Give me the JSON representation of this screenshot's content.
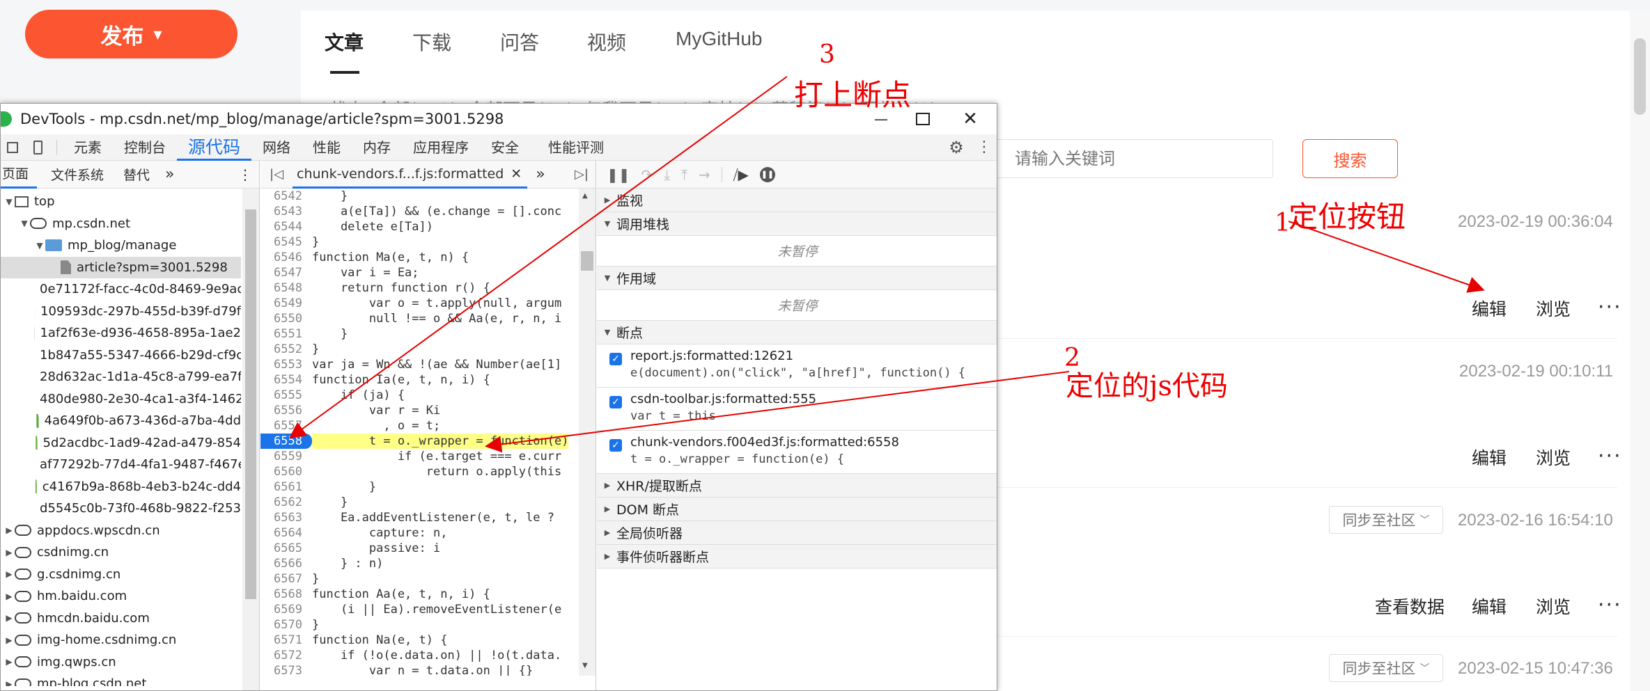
{
  "site": {
    "publish_label": "发布",
    "tabs": [
      "文章",
      "下载",
      "问答",
      "视频",
      "MyGitHub"
    ],
    "subtabs_visible": "状态  全部(112)  全部可见(65)  仅我可见(44)  审核(0)  草稿箱(1)  回收站(6)",
    "search_placeholder": "请输入关键词",
    "search_button": "搜索",
    "articles": [
      {
        "date": "2023-02-19 00:36:04",
        "actions": [
          "编辑",
          "浏览"
        ],
        "more": "···"
      },
      {
        "date": "2023-02-19 00:10:11",
        "actions": [
          "编辑",
          "浏览"
        ],
        "more": "···"
      },
      {
        "date": "2023-02-16 16:54:10",
        "sync": "同步至社区",
        "actions": [
          "查看数据",
          "编辑",
          "浏览"
        ],
        "more": "···"
      },
      {
        "date": "2023-02-15 10:47:36",
        "sync": "同步至社区"
      }
    ]
  },
  "devtools": {
    "title": "DevTools - mp.csdn.net/mp_blog/manage/article?spm=3001.5298",
    "panel_tabs": [
      "元素",
      "控制台",
      "源代码",
      "网络",
      "性能",
      "内存",
      "应用程序",
      "安全",
      "性能评测"
    ],
    "active_panel": "源代码",
    "nav_tabs": [
      "页面",
      "文件系统",
      "替代"
    ],
    "tree": [
      {
        "label": "top",
        "kind": "box",
        "indent": 0,
        "tri": "▼"
      },
      {
        "label": "mp.csdn.net",
        "kind": "cloud",
        "indent": 1,
        "tri": "▼"
      },
      {
        "label": "mp_blog/manage",
        "kind": "folder",
        "indent": 2,
        "tri": "▼"
      },
      {
        "label": "article?spm=3001.5298",
        "kind": "gray",
        "indent": 3,
        "tri": "",
        "selected": true
      },
      {
        "label": "0e71172f-facc-4c0d-8469-9e9ac",
        "kind": "file",
        "indent": 2,
        "tri": ""
      },
      {
        "label": "109593dc-297b-455d-b39f-d79f",
        "kind": "file",
        "indent": 2,
        "tri": ""
      },
      {
        "label": "1af2f63e-d936-4658-895a-1ae2",
        "kind": "file",
        "indent": 2,
        "tri": ""
      },
      {
        "label": "1b847a55-5347-4666-b29d-cf9c",
        "kind": "file",
        "indent": 2,
        "tri": ""
      },
      {
        "label": "28d632ac-1d1a-45c8-a799-ea7f",
        "kind": "file",
        "indent": 2,
        "tri": ""
      },
      {
        "label": "480de980-2e30-4ca1-a3f4-1462",
        "kind": "file",
        "indent": 2,
        "tri": ""
      },
      {
        "label": "4a649f0b-a673-436d-a7ba-4dd",
        "kind": "file",
        "indent": 2,
        "tri": ""
      },
      {
        "label": "5d2acdbc-1ad9-42ad-a479-854",
        "kind": "file",
        "indent": 2,
        "tri": ""
      },
      {
        "label": "af77292b-77d4-4fa1-9487-f467e",
        "kind": "file",
        "indent": 2,
        "tri": ""
      },
      {
        "label": "c4167b9a-868b-4eb3-b24c-dd4",
        "kind": "file",
        "indent": 2,
        "tri": ""
      },
      {
        "label": "d5545c0b-73f0-468b-9822-f253",
        "kind": "file",
        "indent": 2,
        "tri": ""
      },
      {
        "label": "appdocs.wpscdn.cn",
        "kind": "cloud",
        "indent": 0,
        "tri": "▶"
      },
      {
        "label": "csdnimg.cn",
        "kind": "cloud",
        "indent": 0,
        "tri": "▶"
      },
      {
        "label": "g.csdnimg.cn",
        "kind": "cloud",
        "indent": 0,
        "tri": "▶"
      },
      {
        "label": "hm.baidu.com",
        "kind": "cloud",
        "indent": 0,
        "tri": "▶"
      },
      {
        "label": "hmcdn.baidu.com",
        "kind": "cloud",
        "indent": 0,
        "tri": "▶"
      },
      {
        "label": "img-home.csdnimg.cn",
        "kind": "cloud",
        "indent": 0,
        "tri": "▶"
      },
      {
        "label": "img.qwps.cn",
        "kind": "cloud",
        "indent": 0,
        "tri": "▶"
      },
      {
        "label": "mp-blog.csdn.net",
        "kind": "cloud",
        "indent": 0,
        "tri": "▶"
      }
    ],
    "editor_tab": "chunk-vendors.f...f.js:formatted",
    "code": [
      {
        "n": "6542",
        "t": "    }"
      },
      {
        "n": "6543",
        "t": "    a(e[Ta]) && (e.change = [].conc"
      },
      {
        "n": "6544",
        "t": "    delete e[Ta])"
      },
      {
        "n": "6545",
        "t": "}"
      },
      {
        "n": "6546",
        "t": "function Ma(e, t, n) {"
      },
      {
        "n": "6547",
        "t": "    var i = Ea;"
      },
      {
        "n": "6548",
        "t": "    return function r() {"
      },
      {
        "n": "6549",
        "t": "        var o = t.apply(null, argum"
      },
      {
        "n": "6550",
        "t": "        null !== o && Aa(e, r, n, i"
      },
      {
        "n": "6551",
        "t": "    }"
      },
      {
        "n": "6552",
        "t": "}"
      },
      {
        "n": "6553",
        "t": "var ja = Wn && !(ae && Number(ae[1]"
      },
      {
        "n": "6554",
        "t": "function Ia(e, t, n, i) {"
      },
      {
        "n": "6555",
        "t": "    if (ja) {"
      },
      {
        "n": "6556",
        "t": "        var r = Ki"
      },
      {
        "n": "6557",
        "t": "          , o = t;"
      },
      {
        "n": "6558",
        "t": "        t = o._wrapper = function(e)",
        "hl": true
      },
      {
        "n": "6559",
        "t": "            if (e.target === e.curr"
      },
      {
        "n": "6560",
        "t": "                return o.apply(this"
      },
      {
        "n": "6561",
        "t": "        }"
      },
      {
        "n": "6562",
        "t": "    }"
      },
      {
        "n": "6563",
        "t": "    Ea.addEventListener(e, t, le ?"
      },
      {
        "n": "6564",
        "t": "        capture: n,"
      },
      {
        "n": "6565",
        "t": "        passive: i"
      },
      {
        "n": "6566",
        "t": "    } : n)"
      },
      {
        "n": "6567",
        "t": "}"
      },
      {
        "n": "6568",
        "t": "function Aa(e, t, n, i) {"
      },
      {
        "n": "6569",
        "t": "    (i || Ea).removeEventListener(e"
      },
      {
        "n": "6570",
        "t": "}"
      },
      {
        "n": "6571",
        "t": "function Na(e, t) {"
      },
      {
        "n": "6572",
        "t": "    if (!o(e.data.on) || !o(t.data."
      },
      {
        "n": "6573",
        "t": "        var n = t.data.on || {}"
      },
      {
        "n": "6574",
        "t": ""
      }
    ],
    "sections": {
      "watch": "监视",
      "callstack": "调用堆栈",
      "not_paused": "未暂停",
      "scope": "作用域",
      "breakpoints": "断点",
      "xhr": "XHR/提取断点",
      "dom": "DOM 断点",
      "global": "全局侦听器",
      "event": "事件侦听器断点"
    },
    "breakpoints": [
      {
        "file": "report.js:formatted:12621",
        "code": "e(document).on(\"click\", \"a[href]\", function() {"
      },
      {
        "file": "csdn-toolbar.js:formatted:555",
        "code": "var t = this"
      },
      {
        "file": "chunk-vendors.f004ed3f.js:formatted:6558",
        "code": "t = o._wrapper = function(e) {"
      }
    ]
  },
  "annotations": {
    "a1_num": "1",
    "a1_text": "定位按钮",
    "a2_num": "2",
    "a2_text": "定位的js代码",
    "a3_num": "3",
    "a3_text": "打上断点",
    "color": "#e60000"
  }
}
